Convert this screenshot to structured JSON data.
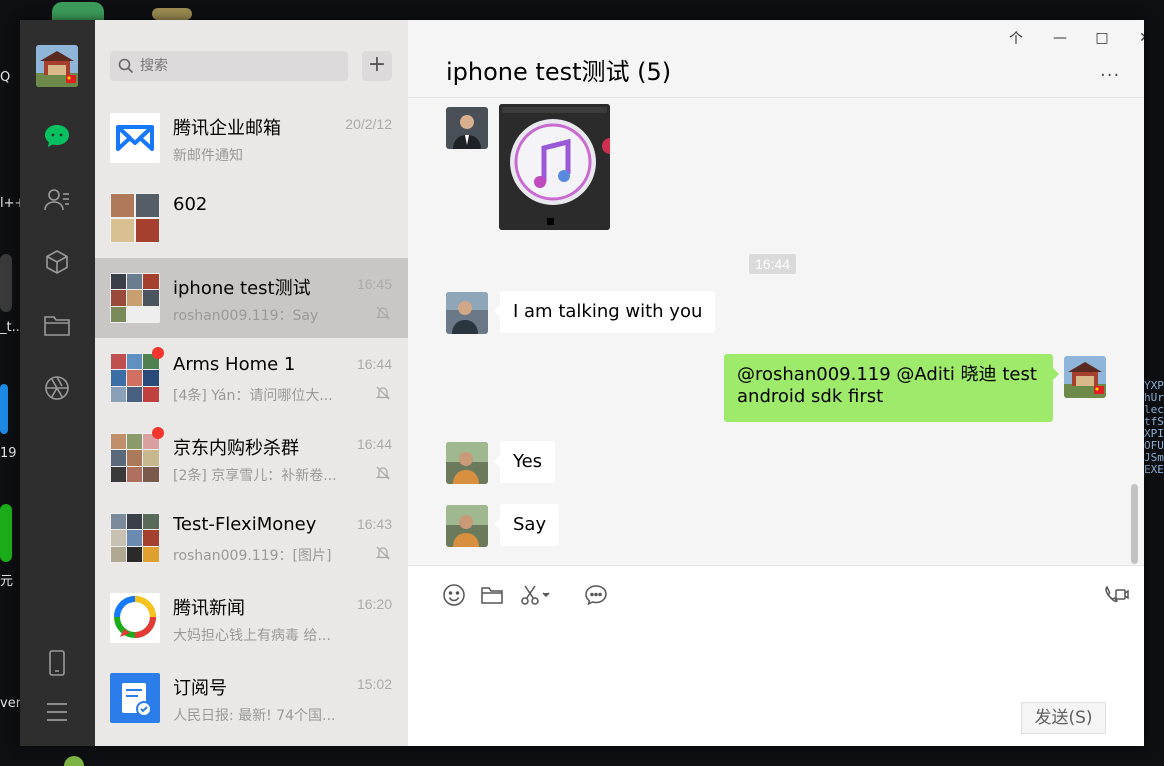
{
  "desktop": {
    "fragments": [
      "Q",
      "l++",
      "_t...",
      "19",
      "元",
      "ver"
    ],
    "right_text": "YXPhUrlectfSXPIOFUJSmEXE"
  },
  "nav": {
    "items": [
      {
        "name": "chat",
        "icon": "chat-icon",
        "active": true
      },
      {
        "name": "contacts",
        "icon": "contacts-icon"
      },
      {
        "name": "mini-programs",
        "icon": "cube-icon"
      },
      {
        "name": "files",
        "icon": "folder-icon"
      },
      {
        "name": "moments",
        "icon": "aperture-icon"
      }
    ],
    "bottom": [
      {
        "icon": "phone-icon"
      },
      {
        "icon": "menu-icon"
      }
    ]
  },
  "search": {
    "placeholder": "搜索"
  },
  "add_label": "+",
  "sessions": [
    {
      "name": "腾讯企业邮箱",
      "time": "20/2/12",
      "preview": "新邮件通知",
      "muted": false,
      "unread": false,
      "avatar": "tencent-mail-logo"
    },
    {
      "name": "602",
      "time": "",
      "preview": "",
      "muted": false,
      "unread": false,
      "avatar": "group-grid"
    },
    {
      "name": "iphone test测试",
      "time": "16:45",
      "preview": "roshan009.119：Say",
      "muted": true,
      "unread": false,
      "active": true,
      "avatar": "group-grid"
    },
    {
      "name": "Arms Home 1",
      "time": "16:44",
      "preview": "[4条] Yán：请问哪位大...",
      "muted": true,
      "unread": true,
      "avatar": "group-grid"
    },
    {
      "name": "京东内购秒杀群",
      "time": "16:44",
      "preview": "[2条] 京享雪儿：补新卷...",
      "muted": true,
      "unread": true,
      "avatar": "group-grid"
    },
    {
      "name": "Test-FlexiMoney",
      "time": "16:43",
      "preview": "roshan009.119：[图片]",
      "muted": true,
      "unread": false,
      "avatar": "group-grid"
    },
    {
      "name": "腾讯新闻",
      "time": "16:20",
      "preview": "大妈担心钱上有病毒 给...",
      "muted": false,
      "unread": false,
      "avatar": "tencent-news-logo"
    },
    {
      "name": "订阅号",
      "time": "15:02",
      "preview": "人民日报: 最新! 74个国...",
      "muted": false,
      "unread": false,
      "avatar": "subscription-logo"
    }
  ],
  "chat": {
    "title": "iphone test测试 (5)",
    "window_controls": [
      "个",
      "—",
      "□",
      "✕"
    ],
    "more": "...",
    "timestamp": "16:44",
    "messages": [
      {
        "side": "left",
        "type": "image",
        "content": "itunes-icon"
      },
      {
        "side": "left",
        "type": "text",
        "text": "I am talking with you"
      },
      {
        "side": "right",
        "type": "text",
        "text": "@roshan009.119 @Aditi 晓迪  test android sdk first"
      },
      {
        "side": "left",
        "type": "text",
        "text": "Yes"
      },
      {
        "side": "left",
        "type": "text",
        "text": "Say"
      }
    ]
  },
  "editor": {
    "tools": [
      "emoji-icon",
      "folder-icon",
      "scissors-icon",
      "chat-bubble-icon"
    ],
    "video_call": "video-call-icon",
    "send_label": "发送(S)"
  }
}
